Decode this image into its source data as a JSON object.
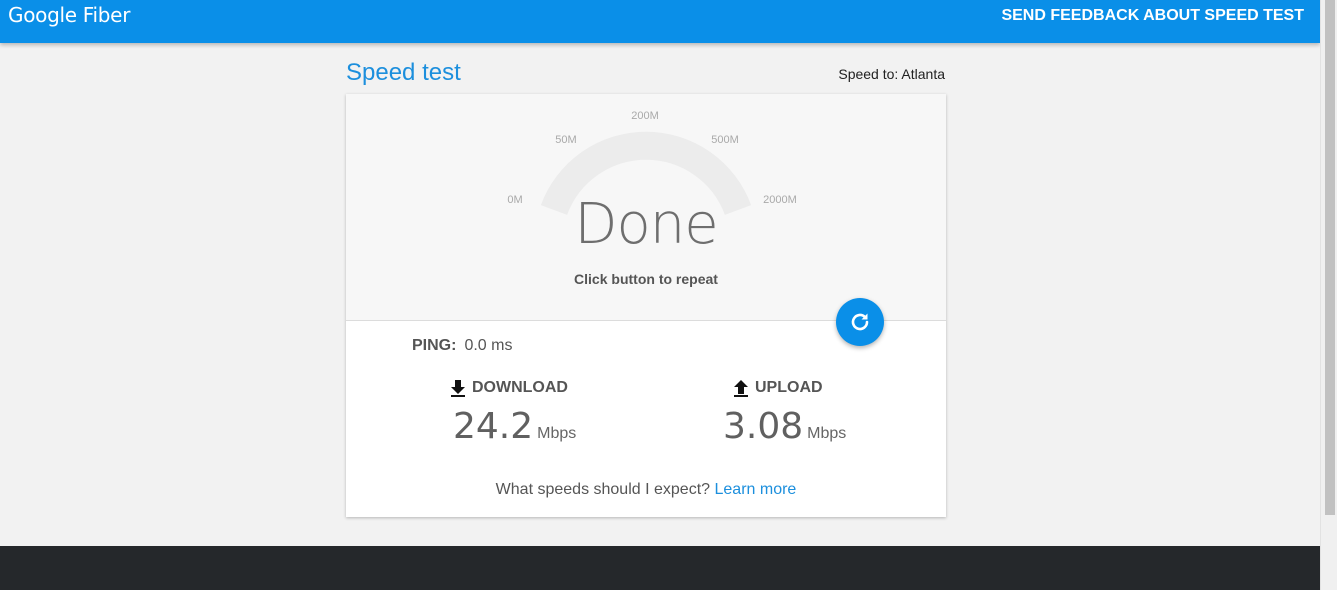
{
  "header": {
    "logo": "Google Fiber",
    "feedback_link": "SEND FEEDBACK ABOUT SPEED TEST",
    "bg_color": "#0a8fe8"
  },
  "page": {
    "title": "Speed test",
    "speed_to": "Speed to: Atlanta"
  },
  "gauge": {
    "ticks": [
      "0M",
      "50M",
      "200M",
      "500M",
      "2000M"
    ],
    "status": "Done",
    "hint": "Click button to repeat"
  },
  "refresh_button": {
    "icon": "refresh-icon"
  },
  "results": {
    "ping_label": "PING:",
    "ping_value": "0.0 ms",
    "download_label": "DOWNLOAD",
    "download_value": "24.2",
    "download_unit": "Mbps",
    "upload_label": "UPLOAD",
    "upload_value": "3.08",
    "upload_unit": "Mbps"
  },
  "footer_text": {
    "question": "What speeds should I expect?",
    "learn_more": "Learn more"
  }
}
